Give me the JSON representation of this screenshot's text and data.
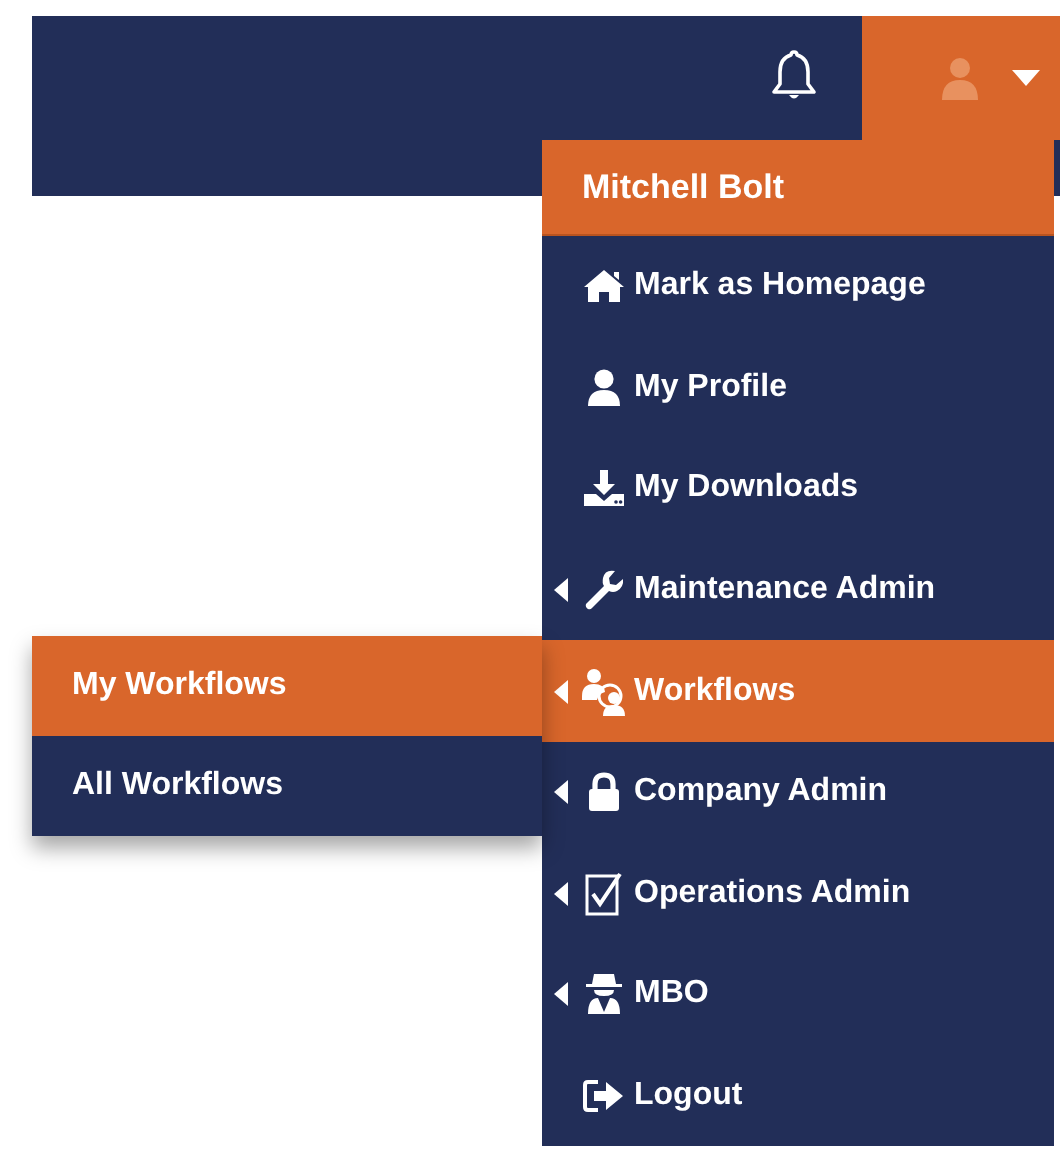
{
  "top_bar": {
    "notifications": {
      "kind": "bell"
    },
    "user_button": {
      "expanded": true
    }
  },
  "user_menu": {
    "name": "Mitchell Bolt",
    "items": [
      {
        "label": "Mark as Homepage",
        "has_submenu": false,
        "selected": false
      },
      {
        "label": "My Profile",
        "has_submenu": false,
        "selected": false
      },
      {
        "label": "My Downloads",
        "has_submenu": false,
        "selected": false
      },
      {
        "label": "Maintenance Admin",
        "has_submenu": true,
        "selected": false
      },
      {
        "label": "Workflows",
        "has_submenu": true,
        "selected": true
      },
      {
        "label": "Company Admin",
        "has_submenu": true,
        "selected": false
      },
      {
        "label": "Operations Admin",
        "has_submenu": true,
        "selected": false
      },
      {
        "label": "MBO",
        "has_submenu": true,
        "selected": false
      },
      {
        "label": "Logout",
        "has_submenu": false,
        "selected": false
      }
    ]
  },
  "submenu": {
    "items": [
      {
        "label": "My Workflows",
        "selected": true
      },
      {
        "label": "All Workflows",
        "selected": false
      }
    ]
  }
}
